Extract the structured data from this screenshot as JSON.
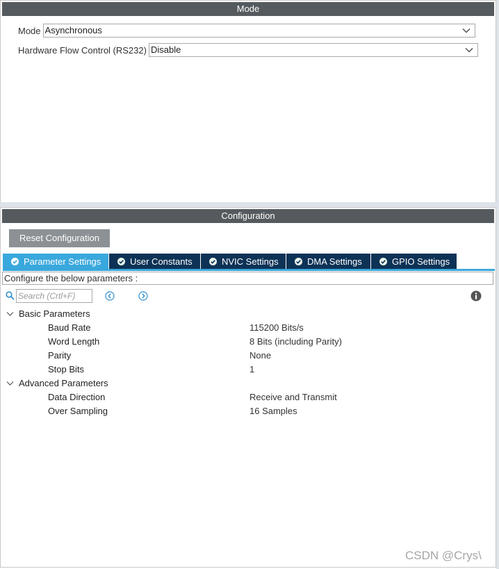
{
  "mode_panel": {
    "title": "Mode",
    "fields": [
      {
        "label": "Mode",
        "value": "Asynchronous"
      },
      {
        "label": "Hardware Flow Control (RS232)",
        "value": "Disable"
      }
    ]
  },
  "config_panel": {
    "title": "Configuration",
    "reset_label": "Reset Configuration",
    "tabs": [
      {
        "label": "Parameter Settings",
        "active": true
      },
      {
        "label": "User Constants",
        "active": false
      },
      {
        "label": "NVIC Settings",
        "active": false
      },
      {
        "label": "DMA Settings",
        "active": false
      },
      {
        "label": "GPIO Settings",
        "active": false
      }
    ],
    "description": "Configure the below parameters :",
    "search": {
      "placeholder": "Search (Crtl+F)",
      "value": ""
    },
    "icons": {
      "search": "search-icon",
      "prev": "chevron-left-circle-icon",
      "next": "chevron-right-circle-icon",
      "info": "info-icon",
      "tab_check": "check-circle-icon"
    },
    "groups": [
      {
        "label": "Basic Parameters",
        "expanded": true,
        "params": [
          {
            "name": "Baud Rate",
            "value": "115200 Bits/s"
          },
          {
            "name": "Word Length",
            "value": "8 Bits (including Parity)"
          },
          {
            "name": "Parity",
            "value": "None"
          },
          {
            "name": "Stop Bits",
            "value": "1"
          }
        ]
      },
      {
        "label": "Advanced Parameters",
        "expanded": true,
        "params": [
          {
            "name": "Data Direction",
            "value": "Receive and Transmit"
          },
          {
            "name": "Over Sampling",
            "value": "16 Samples"
          }
        ]
      }
    ]
  },
  "watermark": "CSDN @Crys\\",
  "colors": {
    "header_bg": "#555a5e",
    "tab_active": "#39a8dc",
    "tab_inactive": "#0d3256",
    "reset_button": "#8c9195",
    "accent": "#39a8dc"
  }
}
